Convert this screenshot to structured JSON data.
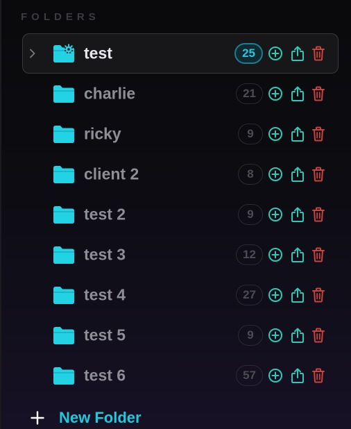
{
  "sidebar": {
    "section_title": "FOLDERS",
    "new_folder_label": "New Folder",
    "folders": [
      {
        "name": "test",
        "count": "25",
        "selected": true,
        "icon": "folder-settings-icon"
      },
      {
        "name": "charlie",
        "count": "21",
        "icon": "folder-icon"
      },
      {
        "name": "ricky",
        "count": "9",
        "icon": "folder-icon"
      },
      {
        "name": "client 2",
        "count": "8",
        "icon": "folder-icon"
      },
      {
        "name": "test 2",
        "count": "9",
        "icon": "folder-icon"
      },
      {
        "name": "test 3",
        "count": "12",
        "icon": "folder-icon"
      },
      {
        "name": "test 4",
        "count": "27",
        "icon": "folder-icon"
      },
      {
        "name": "test 5",
        "count": "9",
        "icon": "folder-icon"
      },
      {
        "name": "test 6",
        "count": "57",
        "icon": "folder-icon"
      }
    ]
  },
  "colors": {
    "accent": "#20c9dd",
    "folder": "#22d3e6",
    "add": "#2fc9b8",
    "share": "#2fc9b8",
    "delete": "#c8423f",
    "background_top": "#0a0a0c",
    "background_bottom": "#161125"
  }
}
